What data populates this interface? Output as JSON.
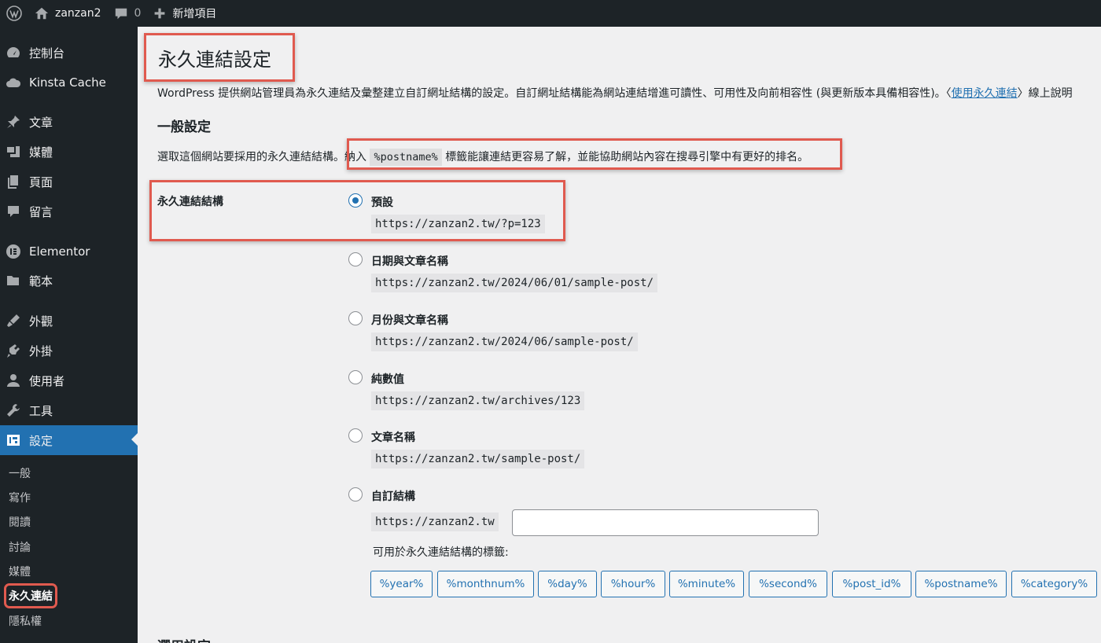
{
  "adminbar": {
    "site_name": "zanzan2",
    "comments_count": "0",
    "new_label": "新增項目"
  },
  "sidebar": {
    "items": [
      {
        "label": "控制台",
        "icon": "dashboard-icon"
      },
      {
        "label": "Kinsta Cache",
        "icon": "cloud-icon"
      },
      {
        "label": "文章",
        "icon": "pin-icon"
      },
      {
        "label": "媒體",
        "icon": "media-icon"
      },
      {
        "label": "頁面",
        "icon": "page-icon"
      },
      {
        "label": "留言",
        "icon": "comment-icon"
      },
      {
        "label": "Elementor",
        "icon": "elementor-icon"
      },
      {
        "label": "範本",
        "icon": "folder-icon"
      },
      {
        "label": "外觀",
        "icon": "brush-icon"
      },
      {
        "label": "外掛",
        "icon": "plugin-icon"
      },
      {
        "label": "使用者",
        "icon": "user-icon"
      },
      {
        "label": "工具",
        "icon": "wrench-icon"
      },
      {
        "label": "設定",
        "icon": "settings-icon"
      }
    ],
    "submenu": [
      "一般",
      "寫作",
      "閱讀",
      "討論",
      "媒體",
      "永久連結",
      "隱私權"
    ]
  },
  "main": {
    "title": "永久連結設定",
    "intro_text": "WordPress 提供網站管理員為永久連結及彙整建立自訂網址結構的設定。自訂網址結構能為網站連結增進可讀性、可用性及向前相容性 (與更新版本具備相容性)。〈",
    "intro_link": "使用永久連結",
    "intro_after": "〉線上說明",
    "section_general": "一般設定",
    "desc_before": "選取這個網站要採用的永久連結結構。",
    "desc_include": "納入",
    "desc_code": "%postname%",
    "desc_after": "標籤能讓連結更容易了解，並能協助網站內容在搜尋引擎中有更好的排名。",
    "structure_label": "永久連結結構",
    "options": [
      {
        "label": "預設",
        "example": "https://zanzan2.tw/?p=123",
        "checked": true
      },
      {
        "label": "日期與文章名稱",
        "example": "https://zanzan2.tw/2024/06/01/sample-post/",
        "checked": false
      },
      {
        "label": "月份與文章名稱",
        "example": "https://zanzan2.tw/2024/06/sample-post/",
        "checked": false
      },
      {
        "label": "純數值",
        "example": "https://zanzan2.tw/archives/123",
        "checked": false
      },
      {
        "label": "文章名稱",
        "example": "https://zanzan2.tw/sample-post/",
        "checked": false
      },
      {
        "label": "自訂結構",
        "example": "https://zanzan2.tw",
        "checked": false
      }
    ],
    "custom_value": "",
    "tags_label": "可用於永久連結結構的標籤:",
    "tags": [
      "%year%",
      "%monthnum%",
      "%day%",
      "%hour%",
      "%minute%",
      "%second%",
      "%post_id%",
      "%postname%",
      "%category%"
    ],
    "section_optional": "選用設定"
  },
  "colors": {
    "accent": "#2271b1",
    "highlight": "#e05a4f",
    "adminbar_bg": "#1d2327"
  }
}
